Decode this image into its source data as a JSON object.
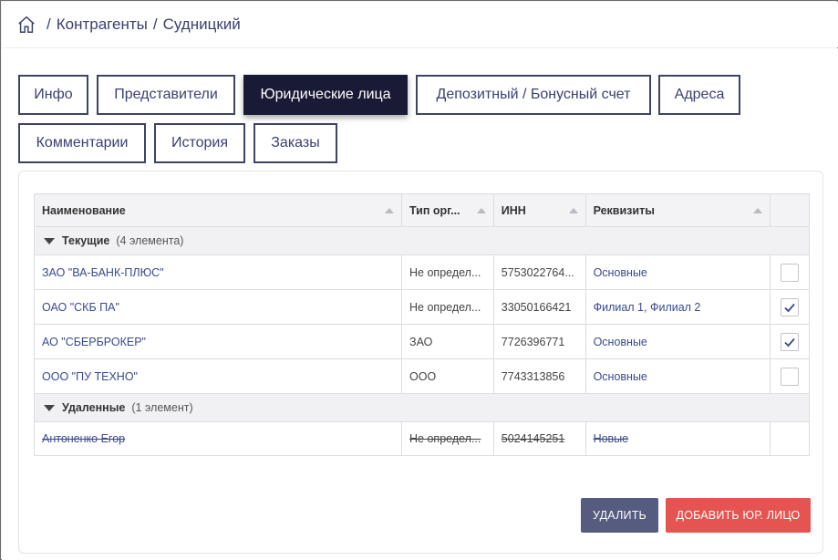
{
  "breadcrumb": {
    "items": [
      "Контрагенты",
      "Судницкий"
    ],
    "separator": "/"
  },
  "tabs": [
    {
      "label": "Инфо",
      "active": false
    },
    {
      "label": "Представители",
      "active": false
    },
    {
      "label": "Юридические лица",
      "active": true
    },
    {
      "label": "Депозитный / Бонусный счет",
      "active": false
    },
    {
      "label": "Адреса",
      "active": false
    },
    {
      "label": "Комментарии",
      "active": false
    },
    {
      "label": "История",
      "active": false
    },
    {
      "label": "Заказы",
      "active": false
    }
  ],
  "grid": {
    "columns": [
      "Наименование",
      "Тип орг...",
      "ИНН",
      "Реквизиты"
    ],
    "groups": [
      {
        "title": "Текущие",
        "count": "(4 элемента)",
        "rows": [
          {
            "name": "ЗАО \"ВА-БАНК-ПЛЮС\"",
            "type": "Не определ...",
            "inn": "5753022764...",
            "details": "Основные",
            "checked": false
          },
          {
            "name": "ОАО \"СКБ ПА\"",
            "type": "Не определ...",
            "inn": "33050166421",
            "details": "Филиал 1, Филиал 2",
            "checked": true
          },
          {
            "name": "АО \"СБЕРБРОКЕР\"",
            "type": "ЗАО",
            "inn": "7726396771",
            "details": "Основные",
            "checked": true
          },
          {
            "name": "ООО \"ПУ ТЕХНО\"",
            "type": "ООО",
            "inn": "7743313856",
            "details": "Основные",
            "checked": false
          }
        ]
      },
      {
        "title": "Удаленные",
        "count": "(1 элемент)",
        "rows": [
          {
            "name": "Антоненко Егор",
            "type": "Не определ...",
            "inn": "5024145251",
            "details": "Новые"
          }
        ]
      }
    ]
  },
  "actions": {
    "delete_label": "УДАЛИТЬ",
    "add_label": "ДОБАВИТЬ ЮР. ЛИЦО"
  },
  "colors": {
    "accent_dark": "#191b36",
    "delete_button": "#565b80",
    "add_button": "#e65451",
    "link": "#3a4a8c"
  },
  "icons": [
    "home-icon",
    "sort-asc-icon",
    "collapse-icon",
    "check-icon"
  ]
}
